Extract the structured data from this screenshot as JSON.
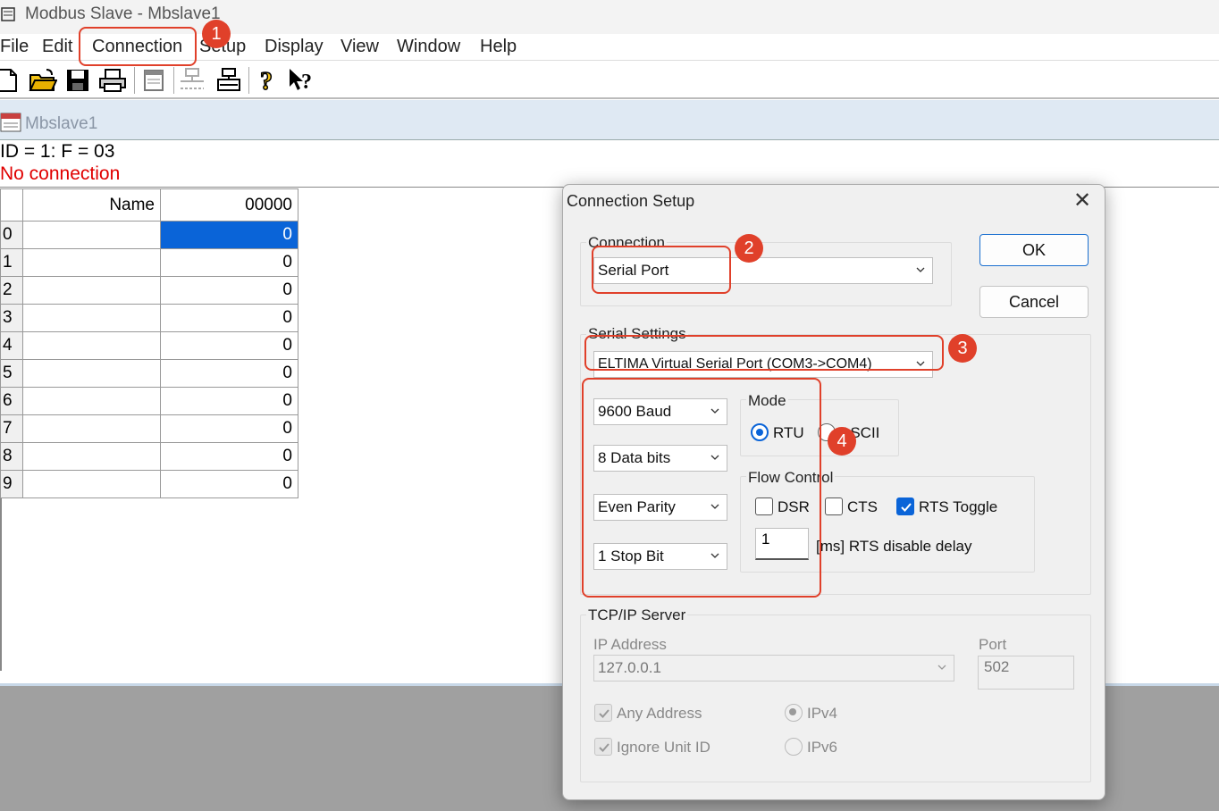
{
  "window": {
    "title": "Modbus Slave - Mbslave1"
  },
  "menu": [
    "File",
    "Edit",
    "Connection",
    "Setup",
    "Display",
    "View",
    "Window",
    "Help"
  ],
  "child": {
    "title": "Mbslave1",
    "info_line1": "ID = 1: F = 03",
    "info_line2": "No connection"
  },
  "grid": {
    "name_header": "Name",
    "value_header": "00000",
    "rows": [
      {
        "index": "0",
        "name": "",
        "value": "0"
      },
      {
        "index": "1",
        "name": "",
        "value": "0"
      },
      {
        "index": "2",
        "name": "",
        "value": "0"
      },
      {
        "index": "3",
        "name": "",
        "value": "0"
      },
      {
        "index": "4",
        "name": "",
        "value": "0"
      },
      {
        "index": "5",
        "name": "",
        "value": "0"
      },
      {
        "index": "6",
        "name": "",
        "value": "0"
      },
      {
        "index": "7",
        "name": "",
        "value": "0"
      },
      {
        "index": "8",
        "name": "",
        "value": "0"
      },
      {
        "index": "9",
        "name": "",
        "value": "0"
      }
    ]
  },
  "badges": [
    "1",
    "2",
    "3",
    "4"
  ],
  "dialog": {
    "title": "Connection Setup",
    "close": "✕",
    "ok": "OK",
    "cancel": "Cancel",
    "connection_label": "Connection",
    "connection_value": "Serial Port",
    "serial_label": "Serial Settings",
    "port_value": "ELTIMA Virtual Serial Port (COM3->COM4)",
    "baud": "9600 Baud",
    "data_bits": "8 Data bits",
    "parity": "Even Parity",
    "stop_bits": "1 Stop Bit",
    "mode_label": "Mode",
    "mode_rtu": "RTU",
    "mode_ascii": "ASCII",
    "flow_label": "Flow Control",
    "dsr": "DSR",
    "cts": "CTS",
    "rts_toggle": "RTS Toggle",
    "rts_delay_value": "1",
    "rts_delay_label": "[ms] RTS disable delay",
    "tcp_label": "TCP/IP Server",
    "ip_label": "IP Address",
    "ip_value": "127.0.0.1",
    "port_label": "Port",
    "port_number": "502",
    "any_address": "Any Address",
    "ignore_unit_id": "Ignore Unit ID",
    "ipv4": "IPv4",
    "ipv6": "IPv6"
  },
  "colors": {
    "accent": "#0a64d8",
    "callout": "#e0402a",
    "error": "#e00000"
  }
}
